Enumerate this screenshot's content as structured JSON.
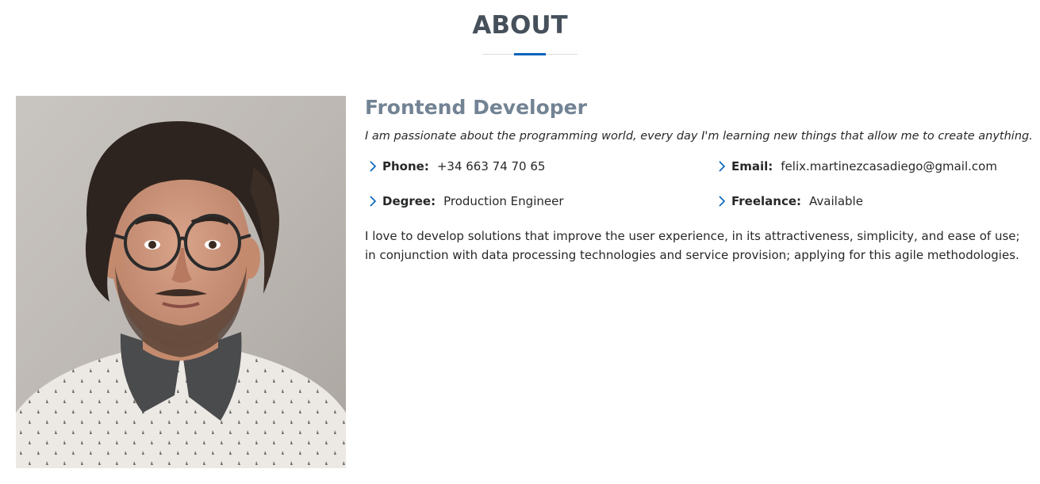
{
  "section": {
    "title": "ABOUT"
  },
  "profile": {
    "photo_alt": "Profile photo",
    "role": "Frontend Developer",
    "tagline": "I am passionate about the programming world, every day I'm learning new things that allow me to create anything.",
    "info": {
      "phone_label": "Phone:",
      "phone_value": "+34 663 74 70 65",
      "email_label": "Email:",
      "email_value": "felix.martinezcasadiego@gmail.com",
      "degree_label": "Degree:",
      "degree_value": "Production Engineer",
      "freelance_label": "Freelance:",
      "freelance_value": "Available"
    },
    "bio": "I love to develop solutions that improve the user experience, in its attractiveness, simplicity, and ease of use; in conjunction with data processing technologies and service provision; applying for this agile methodologies."
  },
  "colors": {
    "accent": "#0563bb",
    "title": "#45505b",
    "role": "#728394",
    "text": "#272829"
  },
  "icons": {
    "bullet": "chevron-right-icon"
  }
}
